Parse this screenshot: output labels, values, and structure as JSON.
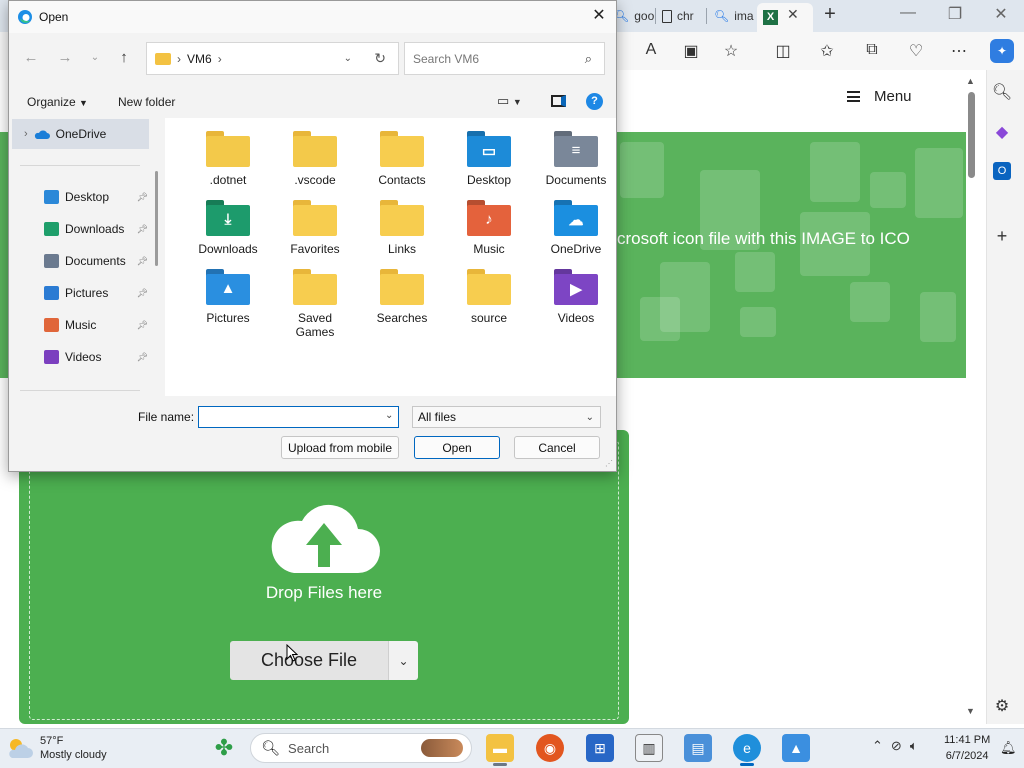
{
  "browser": {
    "tabs": [
      {
        "label": "goo",
        "icon": "search-icon"
      },
      {
        "label": "chr",
        "icon": "document-icon"
      },
      {
        "label": "ima",
        "icon": "search-icon"
      }
    ],
    "new_tab": "+"
  },
  "page": {
    "menu_label": "Menu",
    "hero_text": "crosoft icon file with this IMAGE to ICO",
    "drop_text": "Drop Files here",
    "choose_file": "Choose File"
  },
  "dialog": {
    "title": "Open",
    "breadcrumb": "VM6",
    "search_placeholder": "Search VM6",
    "organize_label": "Organize",
    "new_folder_label": "New folder",
    "help_label": "?",
    "nav": {
      "root": "OneDrive",
      "items": [
        {
          "label": "Desktop",
          "icon": "desktop-icon",
          "color": "#2b88d8"
        },
        {
          "label": "Downloads",
          "icon": "download-icon",
          "color": "#1e9e6a"
        },
        {
          "label": "Documents",
          "icon": "documents-icon",
          "color": "#6b7a8f"
        },
        {
          "label": "Pictures",
          "icon": "pictures-icon",
          "color": "#2b7bd3"
        },
        {
          "label": "Music",
          "icon": "music-icon",
          "color": "#e0663a"
        },
        {
          "label": "Videos",
          "icon": "videos-icon",
          "color": "#7b3fbf"
        }
      ]
    },
    "files": [
      {
        "label": ".dotnet",
        "icon": "folder-icon",
        "kind": "plain",
        "color": "#f3c94a"
      },
      {
        "label": ".vscode",
        "icon": "folder-icon",
        "kind": "plain",
        "color": "#f3c94a"
      },
      {
        "label": "Contacts",
        "icon": "folder-icon",
        "kind": "plain",
        "color": "#f7cd4f"
      },
      {
        "label": "Desktop",
        "icon": "desktop-folder-icon",
        "kind": "special",
        "color": "#1d8bd8",
        "glyph": "▭"
      },
      {
        "label": "Documents",
        "icon": "documents-folder-icon",
        "kind": "special",
        "color": "#7a8799",
        "glyph": "≡"
      },
      {
        "label": "Downloads",
        "icon": "downloads-folder-icon",
        "kind": "special",
        "color": "#1d9b6c",
        "glyph": "⤓"
      },
      {
        "label": "Favorites",
        "icon": "folder-icon",
        "kind": "plain",
        "color": "#f7cd4f"
      },
      {
        "label": "Links",
        "icon": "folder-icon",
        "kind": "plain",
        "color": "#f7cd4f"
      },
      {
        "label": "Music",
        "icon": "music-folder-icon",
        "kind": "special",
        "color": "#e4623c",
        "glyph": "♪"
      },
      {
        "label": "OneDrive",
        "icon": "onedrive-folder-icon",
        "kind": "special",
        "color": "#1b8fe0",
        "glyph": "☁"
      },
      {
        "label": "Pictures",
        "icon": "pictures-folder-icon",
        "kind": "special",
        "color": "#2a8fe0",
        "glyph": "▲"
      },
      {
        "label": "Saved Games",
        "icon": "folder-icon",
        "kind": "plain",
        "color": "#f7cd4f"
      },
      {
        "label": "Searches",
        "icon": "folder-icon",
        "kind": "plain",
        "color": "#f7cd4f"
      },
      {
        "label": "source",
        "icon": "folder-icon",
        "kind": "plain",
        "color": "#f7cd4f"
      },
      {
        "label": "Videos",
        "icon": "videos-folder-icon",
        "kind": "special",
        "color": "#7d45c4",
        "glyph": "▶"
      }
    ],
    "file_name_label": "File name:",
    "file_name_value": "",
    "file_type": "All files",
    "buttons": {
      "upload": "Upload from mobile",
      "open": "Open",
      "cancel": "Cancel"
    }
  },
  "taskbar": {
    "temperature": "57°F",
    "condition": "Mostly cloudy",
    "search_label": "Search",
    "time": "11:41 PM",
    "date": "6/7/2024"
  },
  "colors": {
    "hero_green": "#5ab35c",
    "upload_green": "#4caf50",
    "accent_blue": "#0067c0"
  }
}
